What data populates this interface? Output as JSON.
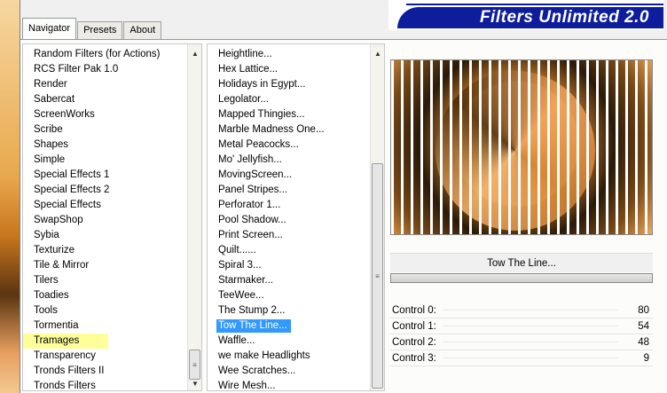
{
  "tabs": [
    {
      "label": "Navigator",
      "active": true
    },
    {
      "label": "Presets",
      "active": false
    },
    {
      "label": "About",
      "active": false
    }
  ],
  "banner": {
    "title": "Filters Unlimited 2.0"
  },
  "categories": {
    "items": [
      "Random Filters (for Actions)",
      "RCS Filter Pak 1.0",
      "Render",
      "Sabercat",
      "ScreenWorks",
      "Scribe",
      "Shapes",
      "Simple",
      "Special Effects 1",
      "Special Effects 2",
      "Special Effects",
      "SwapShop",
      "Sybia",
      "Texturize",
      "Tile & Mirror",
      "Tilers",
      "Toadies",
      "Tools",
      "Tormentia",
      "Tramages",
      "Transparency",
      "Tronds Filters II",
      "Tronds Filters"
    ],
    "selected": "Tramages"
  },
  "filters": {
    "items": [
      "Heightline...",
      "Hex Lattice...",
      "Holidays in Egypt...",
      "Legolator...",
      "Mapped Thingies...",
      "Marble Madness One...",
      "Metal Peacocks...",
      "Mo' Jellyfish...",
      "MovingScreen...",
      "Panel Stripes...",
      "Perforator 1...",
      "Pool Shadow...",
      "Print Screen...",
      "Quilt......",
      "Spiral 3...",
      "Starmaker...",
      "TeeWee...",
      "The Stump 2...",
      "Tow The Line...",
      "Waffle...",
      "we make Headlights",
      "Wee Scratches...",
      "Wire Mesh..."
    ],
    "selected": "Tow The Line..."
  },
  "preview": {
    "filter_name": "Tow The Line..."
  },
  "controls": [
    {
      "label": "Control 0:",
      "value": "80"
    },
    {
      "label": "Control 1:",
      "value": "54"
    },
    {
      "label": "Control 2:",
      "value": "48"
    },
    {
      "label": "Control 3:",
      "value": "9"
    }
  ],
  "colors": {
    "banner": "#0e1d9b",
    "selection": "#3399ff",
    "highlight": "#ffff99"
  }
}
